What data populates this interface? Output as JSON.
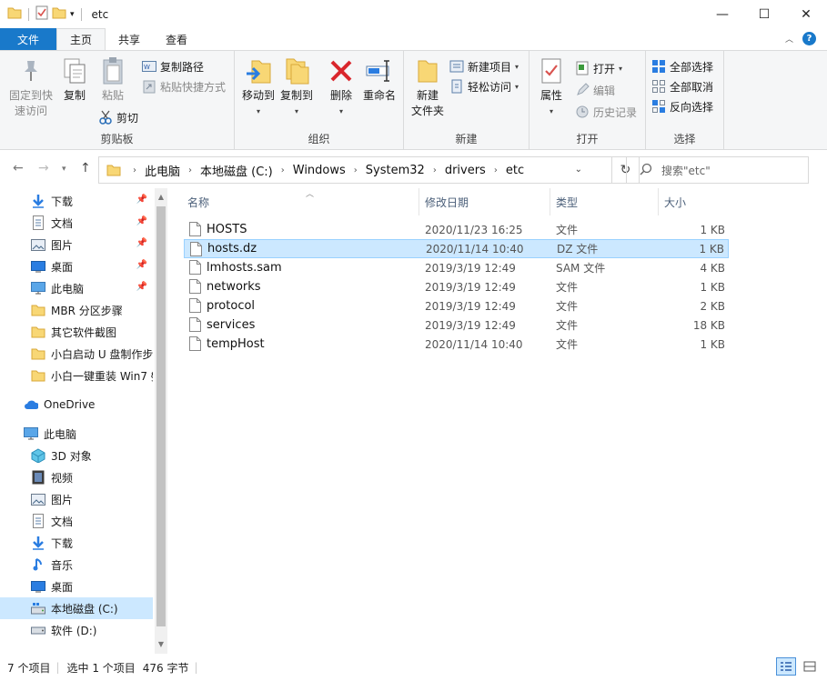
{
  "window": {
    "title": "etc"
  },
  "tabs": [
    {
      "label": "文件"
    },
    {
      "label": "主页"
    },
    {
      "label": "共享"
    },
    {
      "label": "查看"
    }
  ],
  "ribbon": {
    "clipboard": {
      "label": "剪贴板",
      "pin": "固定到快\n速访问",
      "pin_l1": "固定到快",
      "pin_l2": "速访问",
      "copy": "复制",
      "paste": "粘贴",
      "copy_path": "复制路径",
      "paste_shortcut": "粘贴快捷方式",
      "cut": "剪切"
    },
    "organize": {
      "label": "组织",
      "move_to": "移动到",
      "copy_to": "复制到",
      "delete": "删除",
      "rename": "重命名"
    },
    "new": {
      "label": "新建",
      "new_folder_l1": "新建",
      "new_folder_l2": "文件夹",
      "new_item": "新建项目",
      "easy_access": "轻松访问"
    },
    "open": {
      "label": "打开",
      "properties": "属性",
      "open": "打开",
      "edit": "编辑",
      "history": "历史记录"
    },
    "select": {
      "label": "选择",
      "select_all": "全部选择",
      "select_none": "全部取消",
      "invert": "反向选择"
    }
  },
  "address": {
    "crumbs": [
      "此电脑",
      "本地磁盘 (C:)",
      "Windows",
      "System32",
      "drivers",
      "etc"
    ],
    "search_placeholder": "搜索\"etc\""
  },
  "nav": {
    "quick": [
      {
        "label": "下载",
        "icon": "download-icon",
        "pinned": true
      },
      {
        "label": "文档",
        "icon": "document-icon",
        "pinned": true
      },
      {
        "label": "图片",
        "icon": "picture-icon",
        "pinned": true
      },
      {
        "label": "桌面",
        "icon": "desktop-icon",
        "pinned": true
      },
      {
        "label": "此电脑",
        "icon": "computer-icon",
        "pinned": true
      },
      {
        "label": "MBR 分区步骤",
        "icon": "folder-icon",
        "pinned": false
      },
      {
        "label": "其它软件截图",
        "icon": "folder-icon",
        "pinned": false
      },
      {
        "label": "小白启动 U 盘制作步",
        "icon": "folder-icon",
        "pinned": false
      },
      {
        "label": "小白一键重装 Win7 §",
        "icon": "folder-icon",
        "pinned": false
      }
    ],
    "onedrive": "OneDrive",
    "this_pc": "此电脑",
    "pc_items": [
      {
        "label": "3D 对象",
        "icon": "3d-objects-icon"
      },
      {
        "label": "视频",
        "icon": "video-icon"
      },
      {
        "label": "图片",
        "icon": "picture-icon"
      },
      {
        "label": "文档",
        "icon": "document-icon"
      },
      {
        "label": "下载",
        "icon": "download-icon"
      },
      {
        "label": "音乐",
        "icon": "music-icon"
      },
      {
        "label": "桌面",
        "icon": "desktop-icon"
      },
      {
        "label": "本地磁盘 (C:)",
        "icon": "drive-c-icon"
      },
      {
        "label": "软件 (D:)",
        "icon": "drive-d-icon"
      }
    ]
  },
  "columns": {
    "name": "名称",
    "date": "修改日期",
    "type": "类型",
    "size": "大小"
  },
  "files": [
    {
      "name": "HOSTS",
      "date": "2020/11/23 16:25",
      "type": "文件",
      "size": "1 KB",
      "selected": false
    },
    {
      "name": "hosts.dz",
      "date": "2020/11/14 10:40",
      "type": "DZ 文件",
      "size": "1 KB",
      "selected": true
    },
    {
      "name": "lmhosts.sam",
      "date": "2019/3/19 12:49",
      "type": "SAM 文件",
      "size": "4 KB",
      "selected": false
    },
    {
      "name": "networks",
      "date": "2019/3/19 12:49",
      "type": "文件",
      "size": "1 KB",
      "selected": false
    },
    {
      "name": "protocol",
      "date": "2019/3/19 12:49",
      "type": "文件",
      "size": "2 KB",
      "selected": false
    },
    {
      "name": "services",
      "date": "2019/3/19 12:49",
      "type": "文件",
      "size": "18 KB",
      "selected": false
    },
    {
      "name": "tempHost",
      "date": "2020/11/14 10:40",
      "type": "文件",
      "size": "1 KB",
      "selected": false
    }
  ],
  "status": {
    "count": "7 个项目",
    "selected": "选中 1 个项目",
    "size": "476 字节"
  },
  "colors": {
    "accent": "#1979ca",
    "selection": "#cce8ff",
    "folder": "#f8d775"
  }
}
